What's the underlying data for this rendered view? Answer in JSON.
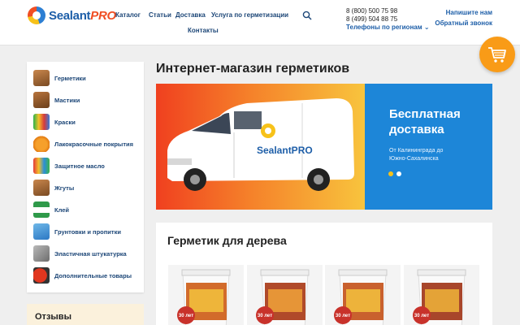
{
  "header": {
    "logo_text": "Sealant",
    "logo_suffix": "PRO",
    "nav": [
      "Каталог",
      "Статьи",
      "Доставка",
      "Услуга по герметизации",
      "Контакты"
    ],
    "phones": [
      "8 (800) 500 75 98",
      "8 (499) 504 88 75"
    ],
    "regions_label": "Телефоны по регионам",
    "write_us": "Напишите нам",
    "callback": "Обратный звонок"
  },
  "sidebar": {
    "items": [
      {
        "label": "Герметики",
        "icon": "house-icon"
      },
      {
        "label": "Мастики",
        "icon": "house-icon"
      },
      {
        "label": "Краски",
        "icon": "paint-brushes-icon"
      },
      {
        "label": "Лакокрасочные покрытия",
        "icon": "paint-can-icon"
      },
      {
        "label": "Защитное масло",
        "icon": "brushes-icon"
      },
      {
        "label": "Жгуты",
        "icon": "house-icon"
      },
      {
        "label": "Клей",
        "icon": "glue-bottle-icon"
      },
      {
        "label": "Грунтовки и пропитки",
        "icon": "roller-icon"
      },
      {
        "label": "Эластичная штукатурка",
        "icon": "trowel-icon"
      },
      {
        "label": "Дополнительные товары",
        "icon": "spray-gun-icon"
      }
    ]
  },
  "reviews": {
    "title": "Отзывы"
  },
  "main": {
    "page_title": "Интернет-магазин герметиков",
    "banner": {
      "van_logo": "SealantPRO",
      "headline_line1": "Бесплатная",
      "headline_line2": "доставка",
      "subtitle_line1": "От Калининграда до",
      "subtitle_line2": "Южно-Сахалинска",
      "active_slide": 1,
      "slide_count": 2
    },
    "product_section": {
      "title": "Герметик для дерева",
      "badge_text": "30 лет",
      "products_visible": 4
    }
  },
  "colors": {
    "brand_blue": "#1d5ea8",
    "accent_orange": "#f99b17",
    "banner_blue": "#1d86d8",
    "dot_active": "#f7c21a"
  }
}
